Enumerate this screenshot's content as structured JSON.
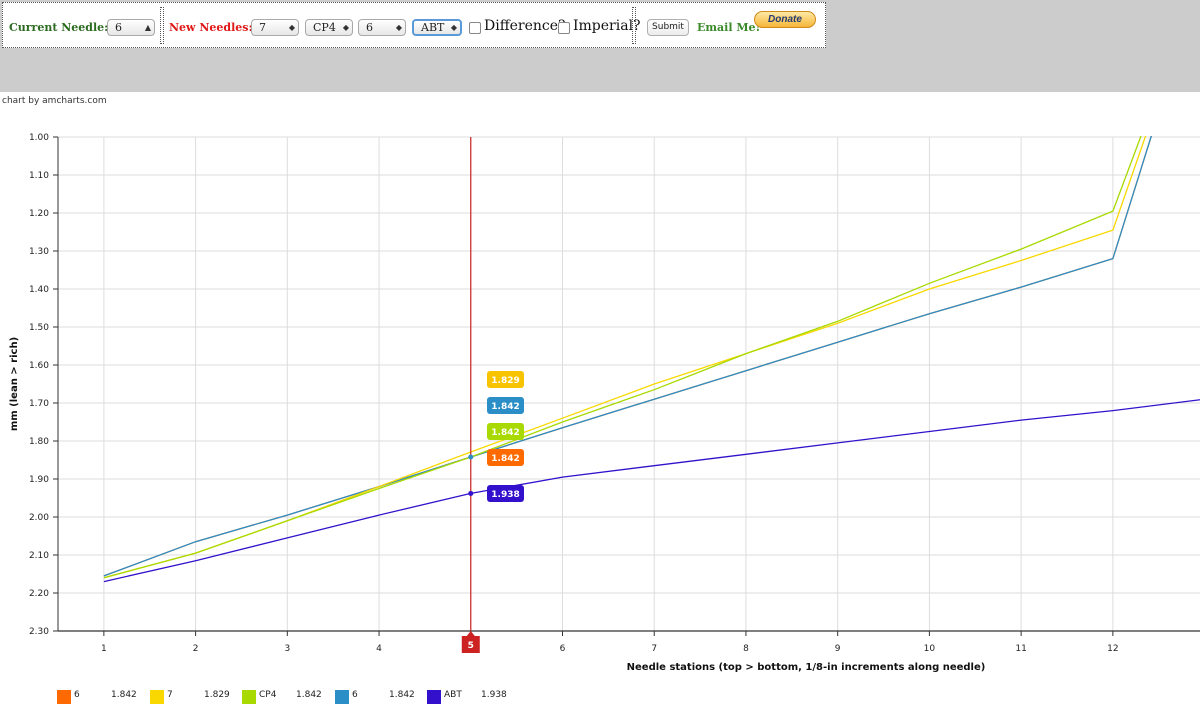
{
  "toolbar": {
    "current_needle_label": "Current Needle:",
    "current_needle_value": "6",
    "new_needles_label": "New Needles:",
    "new_needles": [
      "7",
      "CP4",
      "6",
      "ABT"
    ],
    "difference_label": "Difference?",
    "imperial_label": "Imperial?",
    "submit_label": "Submit",
    "email_label": "Email Me!",
    "donate_label": "Donate"
  },
  "credit": "chart by amcharts.com",
  "colors": {
    "topbar": "#cccccc",
    "cursor": "#cc2222",
    "series": [
      "#ff6a00",
      "#f8d800",
      "#a8d900",
      "#2b8ec6",
      "#3311cc"
    ]
  },
  "chart_data": {
    "type": "line",
    "xlabel": "Needle stations (top > bottom, 1/8-in increments along needle)",
    "ylabel": "mm (lean > rich)",
    "x": [
      1,
      2,
      3,
      4,
      5,
      6,
      7,
      8,
      9,
      10,
      11,
      12,
      13
    ],
    "x_ticks": [
      1,
      2,
      3,
      4,
      5,
      6,
      7,
      8,
      9,
      10,
      11,
      12
    ],
    "xlim": [
      0.5,
      12.95
    ],
    "ylim": [
      1.0,
      2.3
    ],
    "y_inverted": true,
    "y_ticks": [
      "1.00",
      "1.10",
      "1.20",
      "1.30",
      "1.40",
      "1.50",
      "1.60",
      "1.70",
      "1.80",
      "1.90",
      "2.00",
      "2.10",
      "2.20",
      "2.30"
    ],
    "grid": true,
    "cursor_x": 5,
    "cursor_label": "5",
    "series": [
      {
        "name": "6",
        "color": "#ff6a00",
        "values": [
          2.155,
          2.065,
          1.995,
          1.92,
          1.842,
          1.765,
          1.69,
          1.615,
          1.54,
          1.465,
          1.395,
          1.32,
          0.55
        ],
        "label": "1.842"
      },
      {
        "name": "7",
        "color": "#f8d800",
        "values": [
          2.16,
          2.095,
          2.01,
          1.92,
          1.829,
          1.74,
          1.65,
          1.57,
          1.49,
          1.4,
          1.325,
          1.245,
          0.55
        ],
        "label": "1.829"
      },
      {
        "name": "CP4",
        "color": "#a8d900",
        "values": [
          2.16,
          2.095,
          2.01,
          1.925,
          1.842,
          1.75,
          1.665,
          1.57,
          1.485,
          1.385,
          1.295,
          1.195,
          0.55
        ],
        "label": "1.842"
      },
      {
        "name": "6",
        "color": "#2b8ec6",
        "values": [
          2.155,
          2.065,
          1.995,
          1.92,
          1.842,
          1.765,
          1.69,
          1.615,
          1.54,
          1.465,
          1.395,
          1.32,
          0.55
        ],
        "label": "1.842"
      },
      {
        "name": "ABT",
        "color": "#3311cc",
        "values": [
          2.17,
          2.115,
          2.055,
          1.995,
          1.938,
          1.895,
          1.865,
          1.835,
          1.805,
          1.775,
          1.745,
          1.72,
          1.69
        ],
        "label": "1.938"
      }
    ],
    "balloons": [
      {
        "text": "1.829",
        "color": "#f8c300"
      },
      {
        "text": "1.842",
        "color": "#2b8ec6"
      },
      {
        "text": "1.842",
        "color": "#a8d900"
      },
      {
        "text": "1.842",
        "color": "#ff6a00"
      },
      {
        "text": "1.938",
        "color": "#3311cc"
      }
    ],
    "legend": [
      {
        "name": "6",
        "value": "1.842",
        "color": "#ff6a00"
      },
      {
        "name": "7",
        "value": "1.829",
        "color": "#f8d800"
      },
      {
        "name": "CP4",
        "value": "1.842",
        "color": "#a8d900"
      },
      {
        "name": "6",
        "value": "1.842",
        "color": "#2b8ec6"
      },
      {
        "name": "ABT",
        "value": "1.938",
        "color": "#3311cc"
      }
    ]
  }
}
